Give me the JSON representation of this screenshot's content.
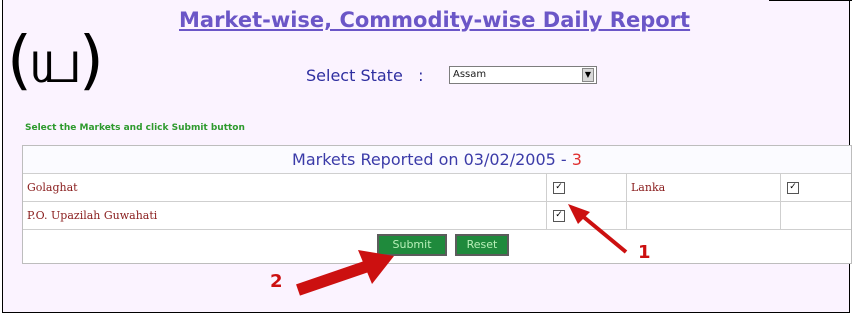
{
  "header": {
    "tamil_mark": "(ய)"
  },
  "title": "Market-wise, Commodity-wise Daily Report",
  "state": {
    "label": "Select State",
    "separator": ":",
    "selected": "Assam"
  },
  "instruction": "Select the Markets and click Submit button",
  "markets": {
    "header_prefix": "Markets Reported on",
    "date": "03/02/2005",
    "dash": "-",
    "count": "3",
    "rows": [
      {
        "market_a": "Golaghat",
        "checked_a": true,
        "market_b": "Lanka",
        "checked_b": true
      },
      {
        "market_a": "P.O. Upazilah Guwahati",
        "checked_a": true,
        "market_b": "",
        "checked_b": null
      }
    ]
  },
  "buttons": {
    "submit": "Submit",
    "reset": "Reset"
  },
  "annotations": {
    "one": "1",
    "two": "2"
  },
  "colors": {
    "title": "#6b56c7",
    "market_text": "#8b2020",
    "button_bg": "#1f8a3c",
    "arrow": "#cc1010",
    "instruction": "#2e9a2e"
  }
}
